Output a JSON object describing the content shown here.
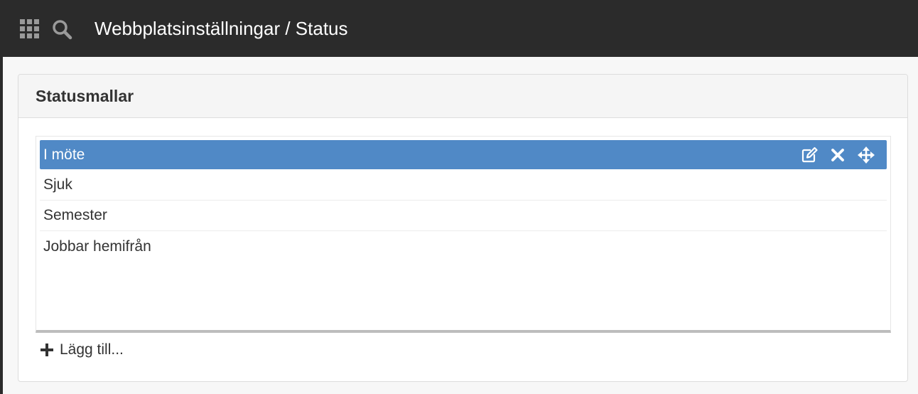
{
  "header": {
    "title": "Webbplatsinställningar / Status",
    "icons": {
      "apps": "apps-grid-icon",
      "search": "search-icon"
    }
  },
  "panel": {
    "title": "Statusmallar",
    "items": [
      {
        "label": "I möte",
        "selected": true
      },
      {
        "label": "Sjuk",
        "selected": false
      },
      {
        "label": "Semester",
        "selected": false
      },
      {
        "label": "Jobbar hemifrån",
        "selected": false
      }
    ],
    "item_action_icons": [
      "edit-icon",
      "close-icon",
      "move-icon"
    ],
    "add_label": "Lägg till..."
  },
  "colors": {
    "topbar": "#2b2b2b",
    "selected_item": "#5089c6",
    "page_background": "#f7f7f7"
  }
}
